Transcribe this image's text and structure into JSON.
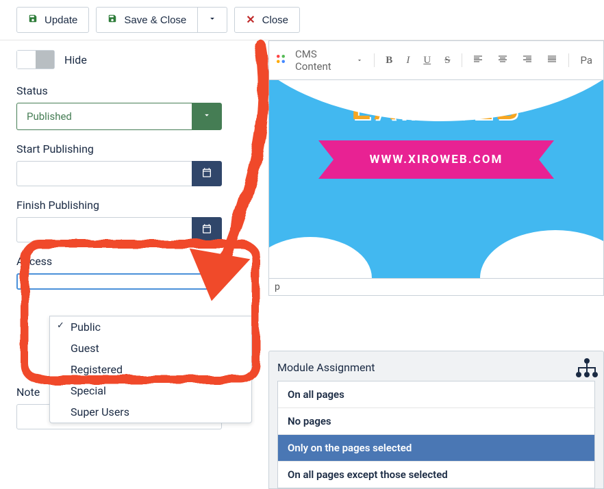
{
  "toolbar": {
    "update": "Update",
    "save_close": "Save & Close",
    "close": "Close"
  },
  "fields": {
    "hide_label": "Hide",
    "status_label": "Status",
    "status_value": "Published",
    "start_pub_label": "Start Publishing",
    "finish_pub_label": "Finish Publishing",
    "access_label": "Access",
    "note_label": "Note"
  },
  "access_options": [
    {
      "label": "Public",
      "checked": true
    },
    {
      "label": "Guest",
      "checked": false
    },
    {
      "label": "Registered",
      "checked": false
    },
    {
      "label": "Special",
      "checked": false
    },
    {
      "label": "Super Users",
      "checked": false
    }
  ],
  "editor": {
    "cms_content": "CMS Content",
    "title_text": "LÀM WEB",
    "banner_url": "WWW.XIROWEB.COM",
    "status_element": "p",
    "paragraph_btn": "Pa"
  },
  "assignment": {
    "title": "Module Assignment",
    "options": [
      {
        "label": "On all pages",
        "selected": false
      },
      {
        "label": "No pages",
        "selected": false
      },
      {
        "label": "Only on the pages selected",
        "selected": true
      },
      {
        "label": "On all pages except those selected",
        "selected": false
      }
    ]
  },
  "colors": {
    "accent_green": "#457d54",
    "accent_blue": "#4a90d9",
    "annot": "#f04a2a"
  }
}
